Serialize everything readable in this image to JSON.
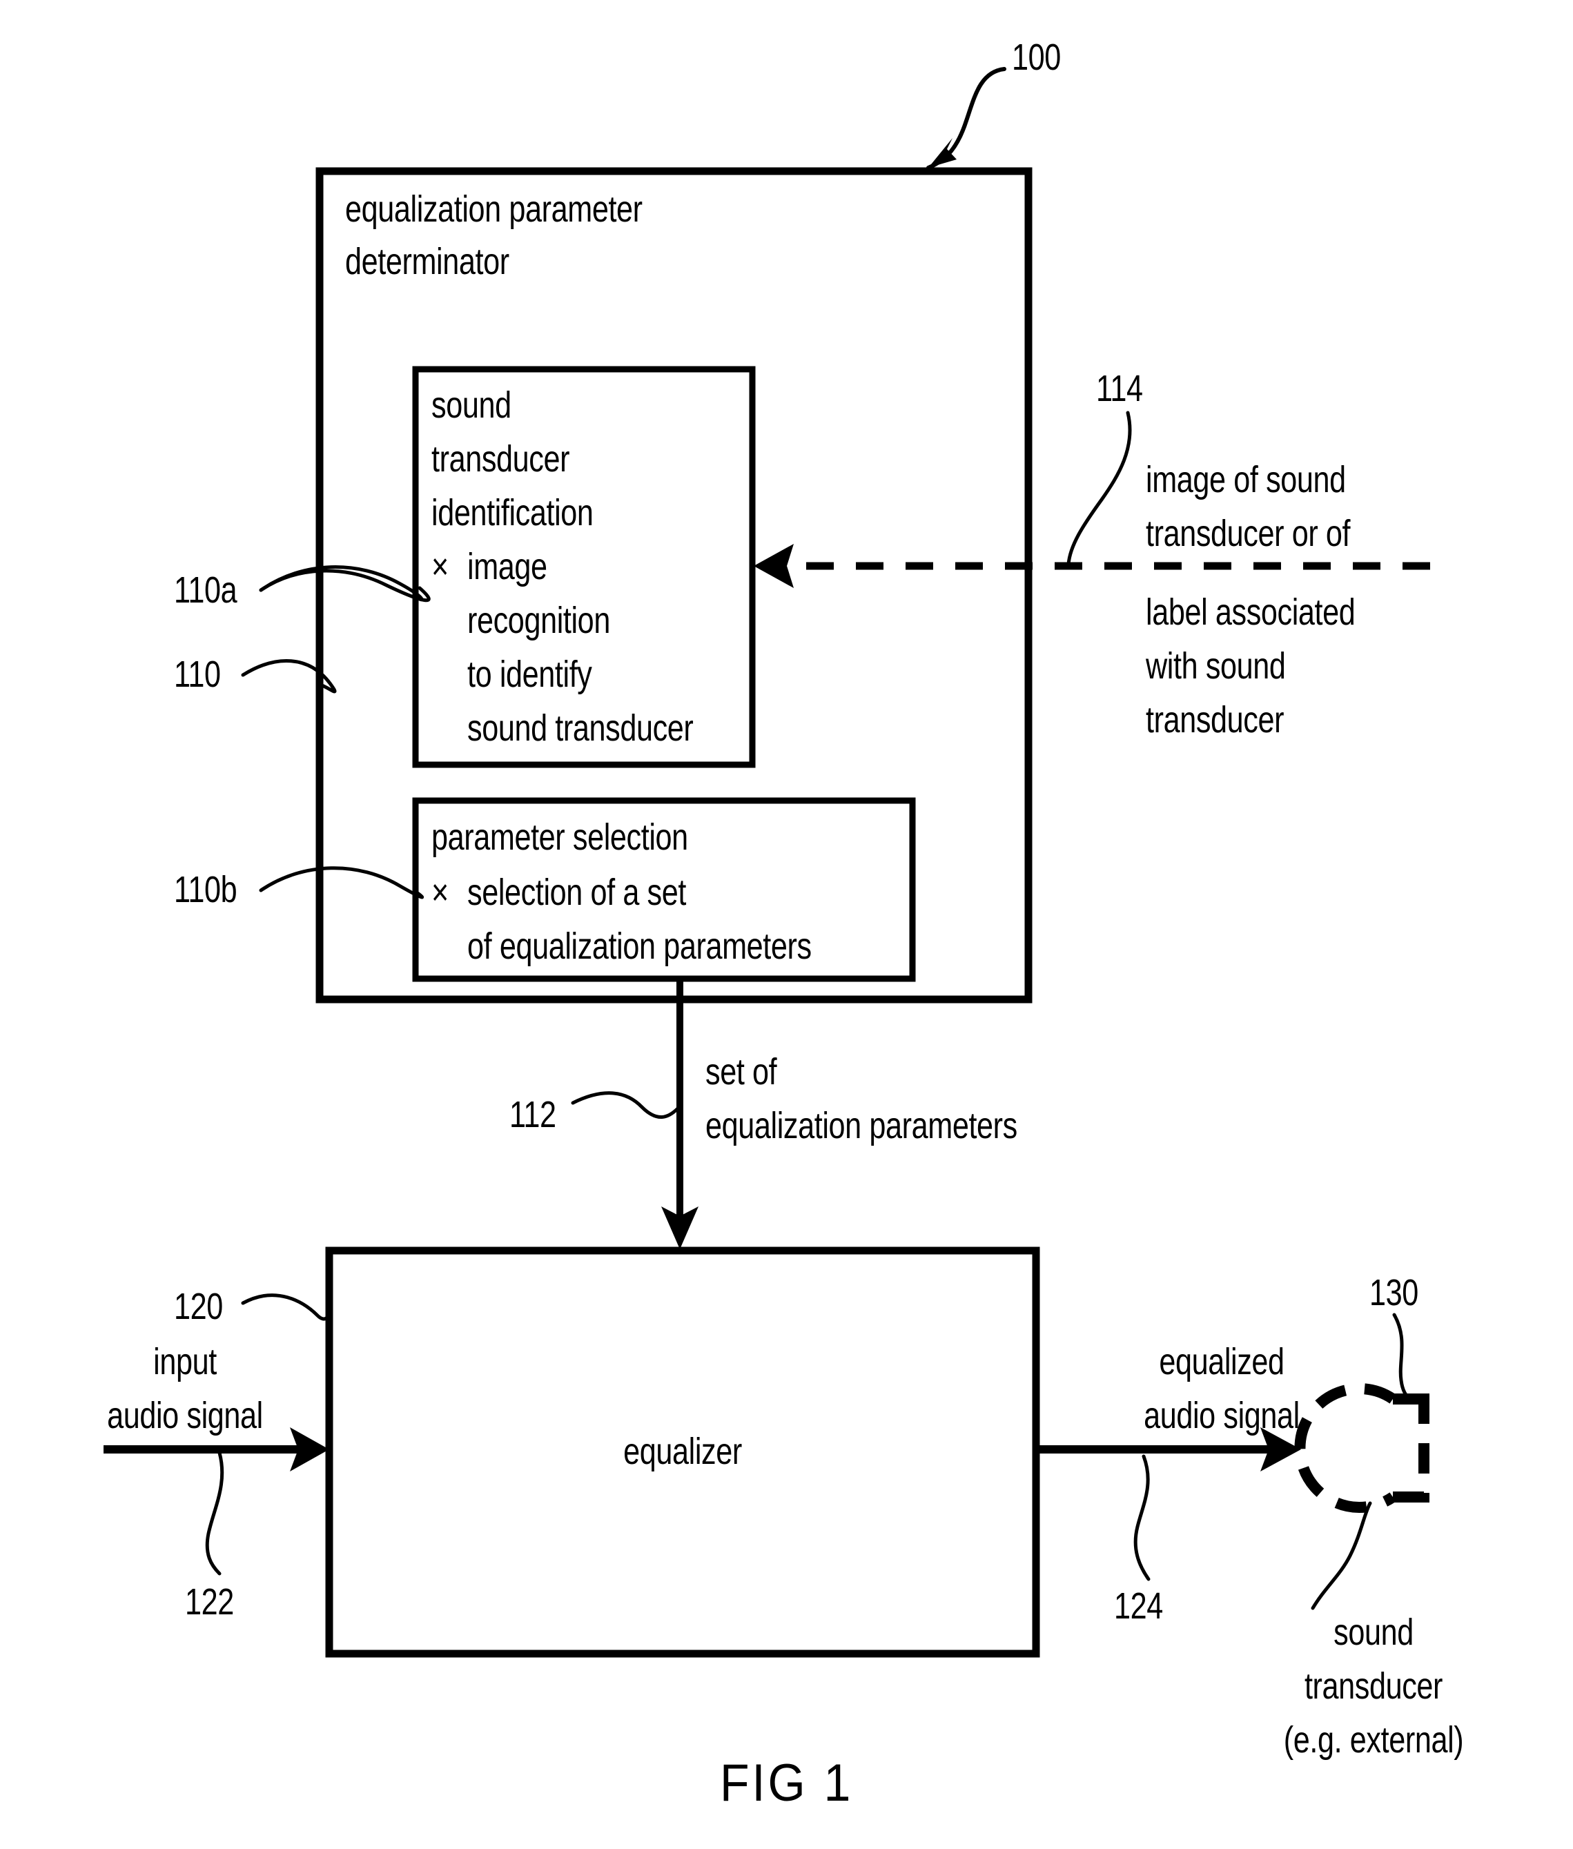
{
  "figure": {
    "caption": "FIG 1",
    "system_ref": "100"
  },
  "outer_block": {
    "ref": "100",
    "title_line1": "equalization parameter",
    "title_line2": "determinator"
  },
  "identification_block": {
    "ref": "110a",
    "parent_ref": "110",
    "title_line1": "sound",
    "title_line2": "transducer",
    "title_line3": "identification",
    "bullet_symbol": "×",
    "bullet_line1": "image",
    "bullet_line2": "recognition",
    "bullet_line3": "to identify",
    "bullet_line4": "sound transducer"
  },
  "parameter_selection_block": {
    "ref": "110b",
    "title": "parameter selection",
    "bullet_symbol": "×",
    "bullet_line1": "selection of a set",
    "bullet_line2": "of equalization parameters"
  },
  "image_input": {
    "ref": "114",
    "line1": "image of sound",
    "line2": "transducer or of",
    "line3": "label associated",
    "line4": "with sound",
    "line5": "transducer"
  },
  "parameters_signal": {
    "ref": "112",
    "line1": "set of",
    "line2": "equalization parameters"
  },
  "equalizer_block": {
    "ref": "120",
    "label": "equalizer"
  },
  "input_signal": {
    "ref": "122",
    "line1": "input",
    "line2": "audio signal"
  },
  "output_signal": {
    "ref": "124",
    "line1": "equalized",
    "line2": "audio signal"
  },
  "sound_transducer": {
    "ref": "130",
    "line1": "sound",
    "line2": "transducer",
    "line3": "(e.g. external)"
  },
  "colors": {
    "ink": "#000000",
    "paper": "#ffffff"
  }
}
